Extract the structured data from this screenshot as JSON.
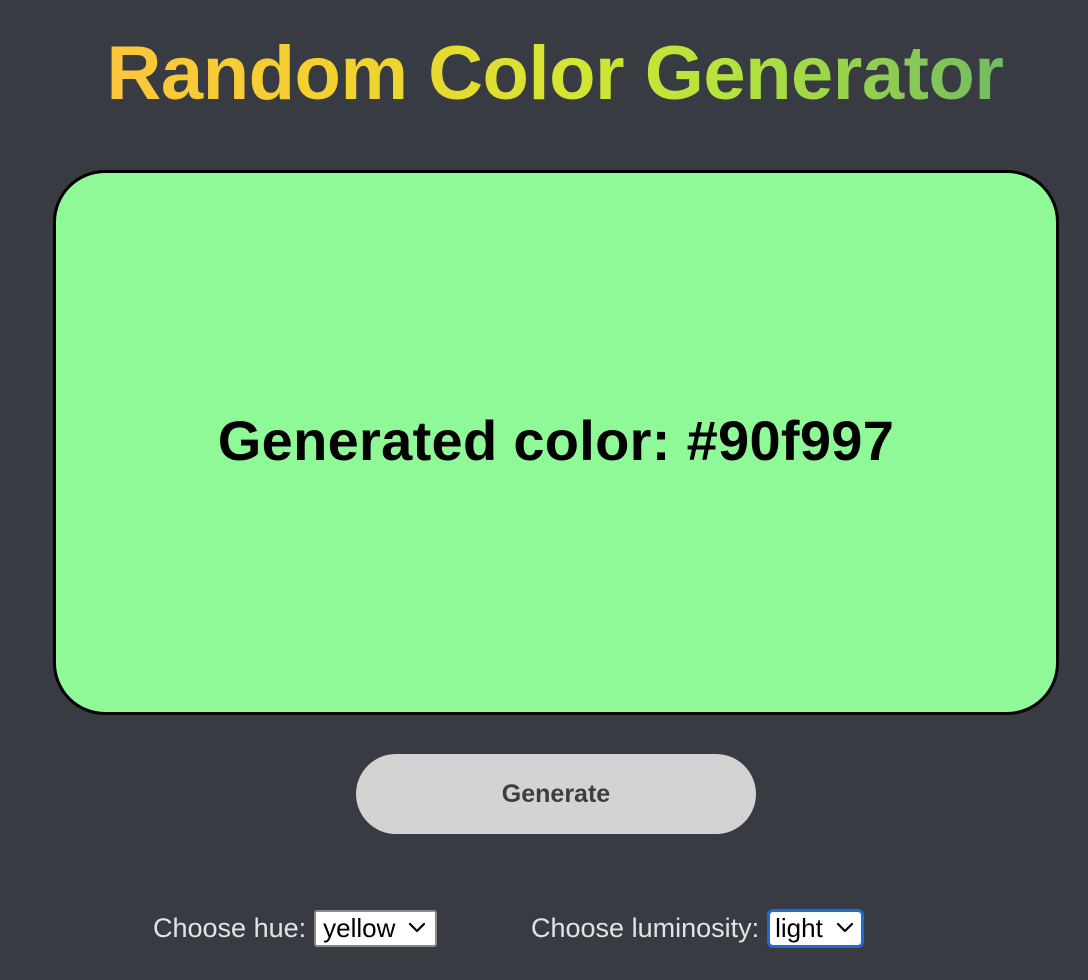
{
  "header": {
    "title": "Random Color Generator"
  },
  "swatch": {
    "text": "Generated color: #90f997",
    "color": "#90f997"
  },
  "generate_button": {
    "label": "Generate"
  },
  "hue": {
    "label": "Choose hue:",
    "selected": "yellow"
  },
  "luminosity": {
    "label": "Choose luminosity:",
    "selected": "light"
  },
  "icons": {
    "hue_dropdown": "chevron-down-icon",
    "luminosity_dropdown": "chevron-down-icon"
  },
  "colors": {
    "background": "#383c42",
    "button": "#d3d3d3",
    "focus_ring": "#1e6ad6",
    "title_gradient_start": "#fcc63a",
    "title_gradient_end": "#73bb63"
  }
}
